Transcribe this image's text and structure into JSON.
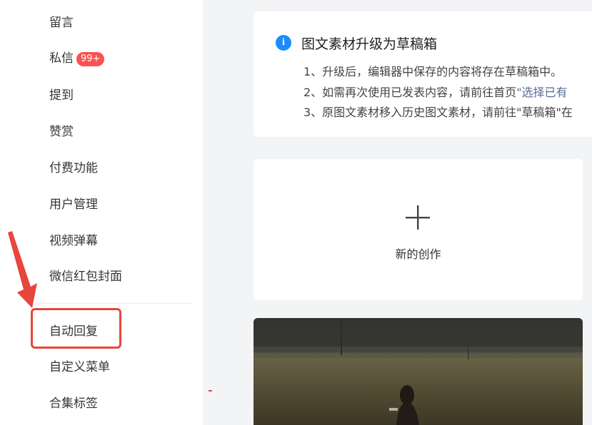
{
  "sidebar": {
    "items": [
      {
        "label": "留言"
      },
      {
        "label": "私信",
        "badge": "99+"
      },
      {
        "label": "提到"
      },
      {
        "label": "赞赏"
      },
      {
        "label": "付费功能"
      },
      {
        "label": "用户管理"
      },
      {
        "label": "视频弹幕"
      },
      {
        "label": "微信红包封面"
      },
      {
        "label": "自动回复"
      },
      {
        "label": "自定义菜单"
      },
      {
        "label": "合集标签"
      }
    ]
  },
  "notice": {
    "icon": "info-icon",
    "title": "图文素材升级为草稿箱",
    "line1": "1、升级后，编辑器中保存的内容将存在草稿箱中。",
    "line2_prefix": "2、如需再次使用已发表内容，请前往首页",
    "line2_link": "\"选择已有",
    "line3": "3、原图文素材移入历史图文素材，请前往\"草稿箱\"在"
  },
  "create": {
    "icon": "plus-icon",
    "label": "新的创作"
  },
  "colors": {
    "accent_red": "#e8453c",
    "badge_red": "#fa5151",
    "info_blue": "#1a8cff",
    "link_blue": "#576b95"
  }
}
